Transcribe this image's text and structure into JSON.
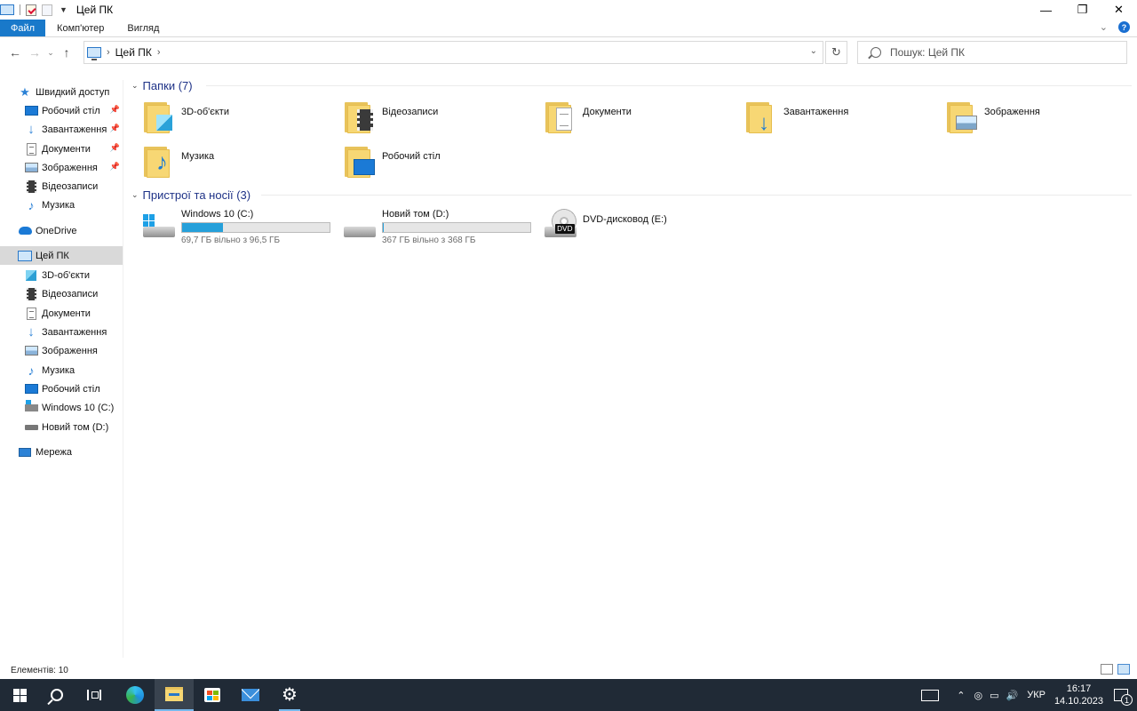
{
  "window": {
    "title": "Цей ПК",
    "controls": {
      "minimize": "—",
      "maximize": "❐",
      "close": "✕"
    }
  },
  "ribbon": {
    "tabs": [
      {
        "label": "Файл",
        "active": true
      },
      {
        "label": "Комп'ютер"
      },
      {
        "label": "Вигляд"
      }
    ],
    "help_icon": "?"
  },
  "nav": {
    "breadcrumb": [
      "Цей ПК"
    ],
    "search_placeholder": "Пошук: Цей ПК"
  },
  "sidebar": {
    "quick_access": "Швидкий доступ",
    "quick_items": [
      {
        "label": "Робочий стіл",
        "icon": "desktop-icon",
        "pinned": true
      },
      {
        "label": "Завантаження",
        "icon": "downloads-icon",
        "pinned": true
      },
      {
        "label": "Документи",
        "icon": "documents-icon",
        "pinned": true
      },
      {
        "label": "Зображення",
        "icon": "pictures-icon",
        "pinned": true
      },
      {
        "label": "Відеозаписи",
        "icon": "videos-icon",
        "pinned": false
      },
      {
        "label": "Музика",
        "icon": "music-icon",
        "pinned": false
      }
    ],
    "onedrive": "OneDrive",
    "this_pc": "Цей ПК",
    "pc_items": [
      {
        "label": "3D-об'єкти",
        "icon": "3d-objects-icon"
      },
      {
        "label": "Відеозаписи",
        "icon": "videos-icon"
      },
      {
        "label": "Документи",
        "icon": "documents-icon"
      },
      {
        "label": "Завантаження",
        "icon": "downloads-icon"
      },
      {
        "label": "Зображення",
        "icon": "pictures-icon"
      },
      {
        "label": "Музика",
        "icon": "music-icon"
      },
      {
        "label": "Робочий стіл",
        "icon": "desktop-icon"
      },
      {
        "label": "Windows 10 (C:)",
        "icon": "system-drive-icon"
      },
      {
        "label": "Новий том (D:)",
        "icon": "drive-icon"
      }
    ],
    "network": "Мережа"
  },
  "content": {
    "folders_header": "Папки (7)",
    "folders": [
      {
        "label": "3D-об'єкти",
        "icon": "3d-objects-folder-icon"
      },
      {
        "label": "Відеозаписи",
        "icon": "videos-folder-icon"
      },
      {
        "label": "Документи",
        "icon": "documents-folder-icon"
      },
      {
        "label": "Завантаження",
        "icon": "downloads-folder-icon"
      },
      {
        "label": "Зображення",
        "icon": "pictures-folder-icon"
      },
      {
        "label": "Музика",
        "icon": "music-folder-icon"
      },
      {
        "label": "Робочий стіл",
        "icon": "desktop-folder-icon"
      }
    ],
    "devices_header": "Пристрої та носії (3)",
    "devices": [
      {
        "label": "Windows 10 (C:)",
        "free": "69,7 ГБ вільно з 96,5 ГБ",
        "used_fraction": 0.28,
        "icon": "system-drive-icon"
      },
      {
        "label": "Новий том (D:)",
        "free": "367 ГБ вільно з 368 ГБ",
        "used_fraction": 0.003,
        "icon": "drive-icon"
      },
      {
        "label": "DVD-дисковод (E:)",
        "icon": "dvd-drive-icon",
        "badge": "DVD"
      }
    ]
  },
  "status": {
    "items_count": "Елементів: 10"
  },
  "taskbar": {
    "language": "УКР",
    "time": "16:17",
    "date": "14.10.2023",
    "accent": "#76b9ed"
  }
}
